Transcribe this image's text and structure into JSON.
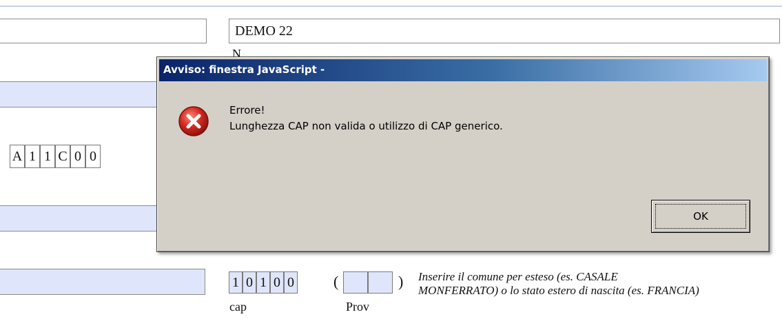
{
  "form": {
    "second_field_value": "DEMO 22",
    "second_field_caption": "N",
    "code_chars": [
      "A",
      "1",
      "1",
      "C",
      "0",
      "0"
    ],
    "cap_digits": [
      "1",
      "0",
      "1",
      "0",
      "0"
    ],
    "cap_label": "cap",
    "prov_label": "Prov",
    "paren_open": "(",
    "paren_close": ")",
    "hint_line1": "Inserire il comune per esteso (es. CASALE",
    "hint_line2": "MONFERRATO) o lo stato estero di nascita (es. FRANCIA)"
  },
  "dialog": {
    "title": "Avviso: finestra JavaScript -",
    "message_line1": "Errore!",
    "message_line2": "Lunghezza CAP non valida o utilizzo di CAP generico.",
    "ok_label": "OK",
    "icon": "error-icon"
  },
  "colors": {
    "field_blue": "#dfe5fb",
    "dialog_bg": "#d4d0c8",
    "title_gradient_start": "#0a246a",
    "title_gradient_end": "#a6caf0",
    "error_red": "#d4281f"
  }
}
